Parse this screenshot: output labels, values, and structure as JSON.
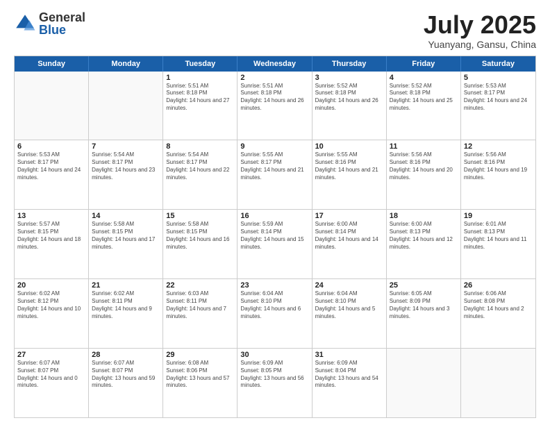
{
  "logo": {
    "general": "General",
    "blue": "Blue"
  },
  "header": {
    "month": "July 2025",
    "location": "Yuanyang, Gansu, China"
  },
  "days": [
    "Sunday",
    "Monday",
    "Tuesday",
    "Wednesday",
    "Thursday",
    "Friday",
    "Saturday"
  ],
  "weeks": [
    [
      {
        "day": "",
        "info": ""
      },
      {
        "day": "",
        "info": ""
      },
      {
        "day": "1",
        "info": "Sunrise: 5:51 AM\nSunset: 8:18 PM\nDaylight: 14 hours and 27 minutes."
      },
      {
        "day": "2",
        "info": "Sunrise: 5:51 AM\nSunset: 8:18 PM\nDaylight: 14 hours and 26 minutes."
      },
      {
        "day": "3",
        "info": "Sunrise: 5:52 AM\nSunset: 8:18 PM\nDaylight: 14 hours and 26 minutes."
      },
      {
        "day": "4",
        "info": "Sunrise: 5:52 AM\nSunset: 8:18 PM\nDaylight: 14 hours and 25 minutes."
      },
      {
        "day": "5",
        "info": "Sunrise: 5:53 AM\nSunset: 8:17 PM\nDaylight: 14 hours and 24 minutes."
      }
    ],
    [
      {
        "day": "6",
        "info": "Sunrise: 5:53 AM\nSunset: 8:17 PM\nDaylight: 14 hours and 24 minutes."
      },
      {
        "day": "7",
        "info": "Sunrise: 5:54 AM\nSunset: 8:17 PM\nDaylight: 14 hours and 23 minutes."
      },
      {
        "day": "8",
        "info": "Sunrise: 5:54 AM\nSunset: 8:17 PM\nDaylight: 14 hours and 22 minutes."
      },
      {
        "day": "9",
        "info": "Sunrise: 5:55 AM\nSunset: 8:17 PM\nDaylight: 14 hours and 21 minutes."
      },
      {
        "day": "10",
        "info": "Sunrise: 5:55 AM\nSunset: 8:16 PM\nDaylight: 14 hours and 21 minutes."
      },
      {
        "day": "11",
        "info": "Sunrise: 5:56 AM\nSunset: 8:16 PM\nDaylight: 14 hours and 20 minutes."
      },
      {
        "day": "12",
        "info": "Sunrise: 5:56 AM\nSunset: 8:16 PM\nDaylight: 14 hours and 19 minutes."
      }
    ],
    [
      {
        "day": "13",
        "info": "Sunrise: 5:57 AM\nSunset: 8:15 PM\nDaylight: 14 hours and 18 minutes."
      },
      {
        "day": "14",
        "info": "Sunrise: 5:58 AM\nSunset: 8:15 PM\nDaylight: 14 hours and 17 minutes."
      },
      {
        "day": "15",
        "info": "Sunrise: 5:58 AM\nSunset: 8:15 PM\nDaylight: 14 hours and 16 minutes."
      },
      {
        "day": "16",
        "info": "Sunrise: 5:59 AM\nSunset: 8:14 PM\nDaylight: 14 hours and 15 minutes."
      },
      {
        "day": "17",
        "info": "Sunrise: 6:00 AM\nSunset: 8:14 PM\nDaylight: 14 hours and 14 minutes."
      },
      {
        "day": "18",
        "info": "Sunrise: 6:00 AM\nSunset: 8:13 PM\nDaylight: 14 hours and 12 minutes."
      },
      {
        "day": "19",
        "info": "Sunrise: 6:01 AM\nSunset: 8:13 PM\nDaylight: 14 hours and 11 minutes."
      }
    ],
    [
      {
        "day": "20",
        "info": "Sunrise: 6:02 AM\nSunset: 8:12 PM\nDaylight: 14 hours and 10 minutes."
      },
      {
        "day": "21",
        "info": "Sunrise: 6:02 AM\nSunset: 8:11 PM\nDaylight: 14 hours and 9 minutes."
      },
      {
        "day": "22",
        "info": "Sunrise: 6:03 AM\nSunset: 8:11 PM\nDaylight: 14 hours and 7 minutes."
      },
      {
        "day": "23",
        "info": "Sunrise: 6:04 AM\nSunset: 8:10 PM\nDaylight: 14 hours and 6 minutes."
      },
      {
        "day": "24",
        "info": "Sunrise: 6:04 AM\nSunset: 8:10 PM\nDaylight: 14 hours and 5 minutes."
      },
      {
        "day": "25",
        "info": "Sunrise: 6:05 AM\nSunset: 8:09 PM\nDaylight: 14 hours and 3 minutes."
      },
      {
        "day": "26",
        "info": "Sunrise: 6:06 AM\nSunset: 8:08 PM\nDaylight: 14 hours and 2 minutes."
      }
    ],
    [
      {
        "day": "27",
        "info": "Sunrise: 6:07 AM\nSunset: 8:07 PM\nDaylight: 14 hours and 0 minutes."
      },
      {
        "day": "28",
        "info": "Sunrise: 6:07 AM\nSunset: 8:07 PM\nDaylight: 13 hours and 59 minutes."
      },
      {
        "day": "29",
        "info": "Sunrise: 6:08 AM\nSunset: 8:06 PM\nDaylight: 13 hours and 57 minutes."
      },
      {
        "day": "30",
        "info": "Sunrise: 6:09 AM\nSunset: 8:05 PM\nDaylight: 13 hours and 56 minutes."
      },
      {
        "day": "31",
        "info": "Sunrise: 6:09 AM\nSunset: 8:04 PM\nDaylight: 13 hours and 54 minutes."
      },
      {
        "day": "",
        "info": ""
      },
      {
        "day": "",
        "info": ""
      }
    ]
  ]
}
